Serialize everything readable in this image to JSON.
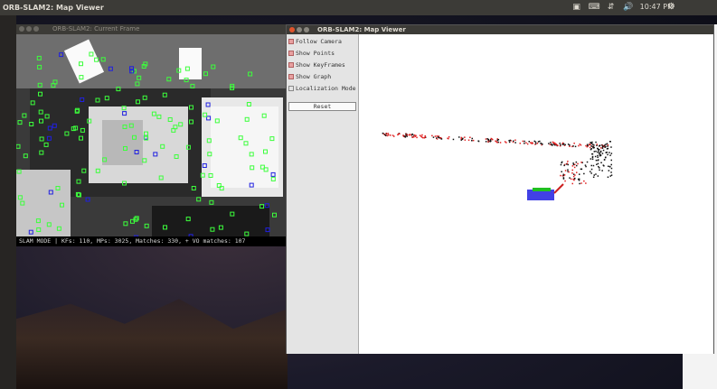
{
  "topbar": {
    "title": "ORB-SLAM2: Map Viewer",
    "clock": "10:47 PM"
  },
  "launcher": {
    "icons": [
      "home-icon",
      "firefox-icon",
      "terminal-icon",
      "files-icon",
      "writer-icon",
      "calc-icon",
      "impress-icon",
      "software-center-icon",
      "ubuntu-one-icon",
      "settings-icon",
      "disk-icon",
      "app-icon",
      "app-icon",
      "app-icon",
      "app-icon",
      "app-icon",
      "app-icon",
      "app-icon",
      "trash-icon"
    ]
  },
  "current_frame": {
    "title": "ORB-SLAM2: Current Frame",
    "status": "SLAM MODE |  KFs: 110, MPs: 3025, Matches: 330, + VO matches: 107"
  },
  "map_viewer": {
    "title": "ORB-SLAM2: Map Viewer",
    "options": [
      {
        "label": "Follow Camera",
        "checked": true
      },
      {
        "label": "Show Points",
        "checked": true
      },
      {
        "label": "Show KeyFrames",
        "checked": true
      },
      {
        "label": "Show Graph",
        "checked": true
      },
      {
        "label": "Localization Mode",
        "checked": false
      }
    ],
    "reset_label": "Reset"
  },
  "colors": {
    "keypoint": "#3cff3c",
    "keyframe": "#2020e0",
    "map_point": "#111111",
    "ref_point": "#e02020",
    "current_camera": "#20c020"
  }
}
